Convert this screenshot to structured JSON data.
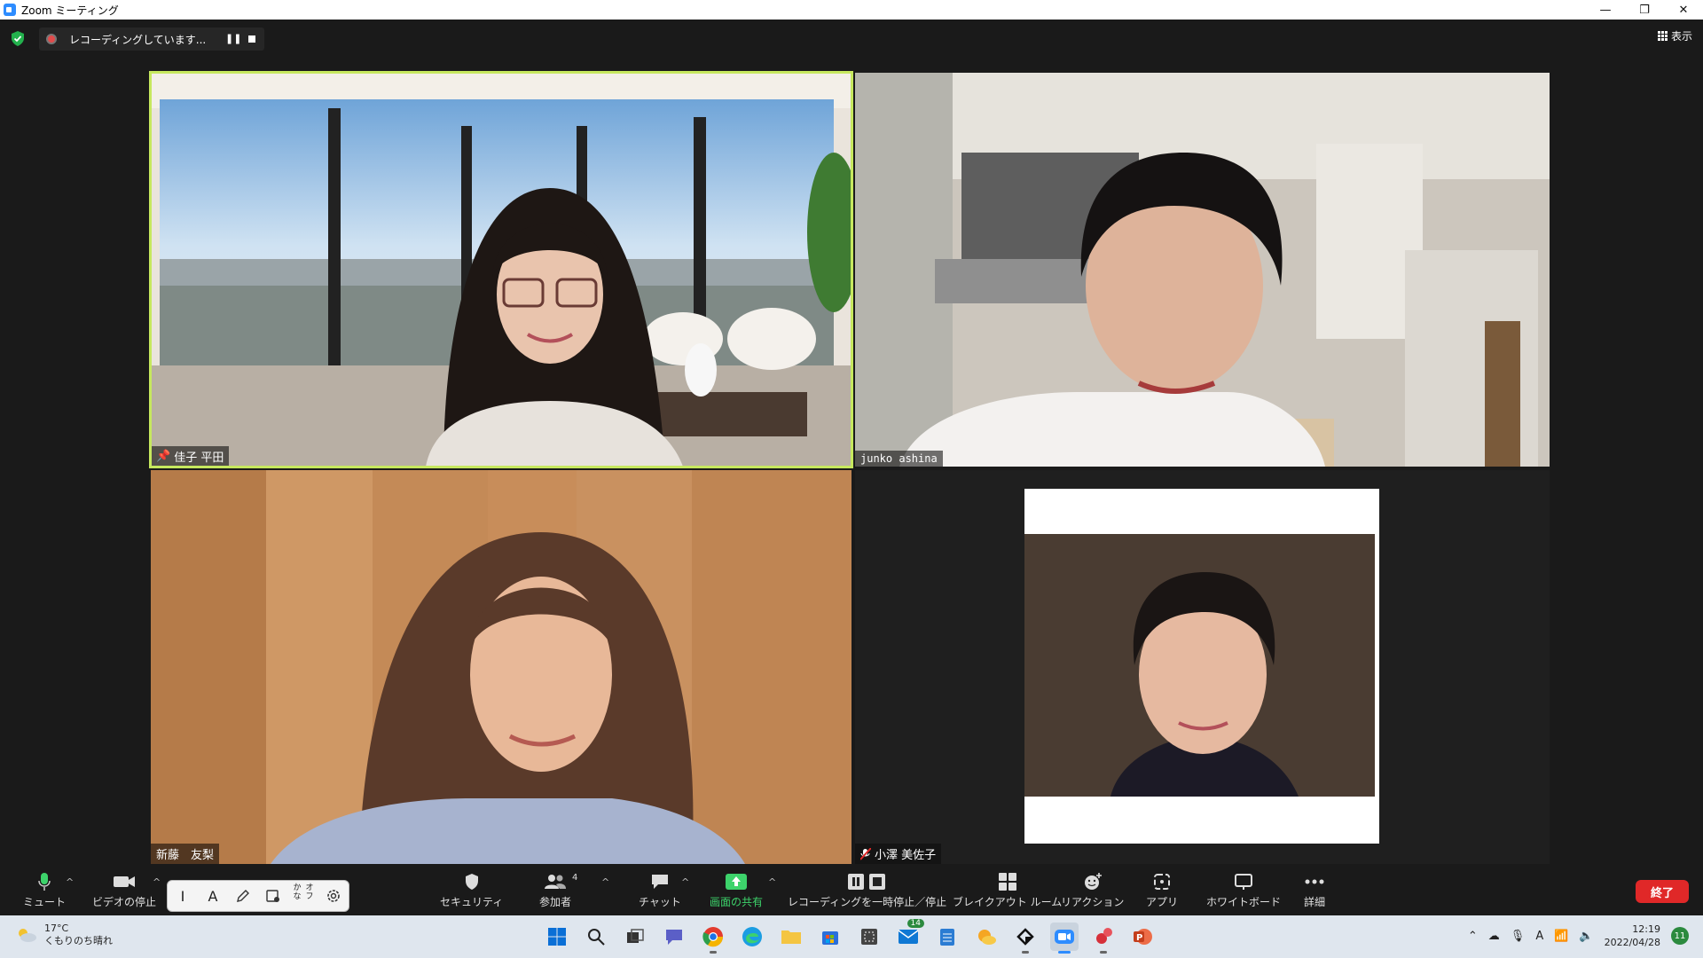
{
  "window": {
    "title": "Zoom ミーティング",
    "minimize": "—",
    "restore": "❐",
    "close": "✕"
  },
  "recording": {
    "status_text": "レコーディングしています...",
    "pause_glyph": "❚❚"
  },
  "view_button": {
    "label": "表示"
  },
  "participants": [
    {
      "name": "佳子 平田",
      "pinned": true,
      "active_speaker": true
    },
    {
      "name": "junko ashina",
      "pinned": false,
      "active_speaker": false
    },
    {
      "name": "新藤　友梨",
      "pinned": false,
      "active_speaker": false
    },
    {
      "name": "小澤 美佐子",
      "pinned": false,
      "muted": true,
      "active_speaker": false
    }
  ],
  "toolbar": {
    "mute": "ミュート",
    "video": "ビデオの停止",
    "security": "セキュリティ",
    "participants": "参加者",
    "participants_count": "4",
    "chat": "チャット",
    "share": "画面の共有",
    "recording_control": "レコーディングを一時停止／停止",
    "breakout": "ブレイクアウト ルーム",
    "reactions": "リアクション",
    "apps": "アプリ",
    "whiteboard": "ホワイトボード",
    "more": "詳細",
    "end": "終了",
    "caret": "^"
  },
  "ime_bar": {
    "cursor": "I",
    "mode": "A",
    "kana_line1": "かな",
    "kana_line2": "オフ"
  },
  "taskbar": {
    "weather_temp": "17°C",
    "weather_desc": "くもりのち晴れ",
    "mail_badge": "14",
    "time": "12:19",
    "date": "2022/04/28",
    "notifications": "11",
    "ime_indicator": "A"
  },
  "colors": {
    "active_speaker_border": "#c6e85e",
    "share_green": "#3dd36b",
    "end_red": "#e02828",
    "record_red": "#e14b4b"
  }
}
